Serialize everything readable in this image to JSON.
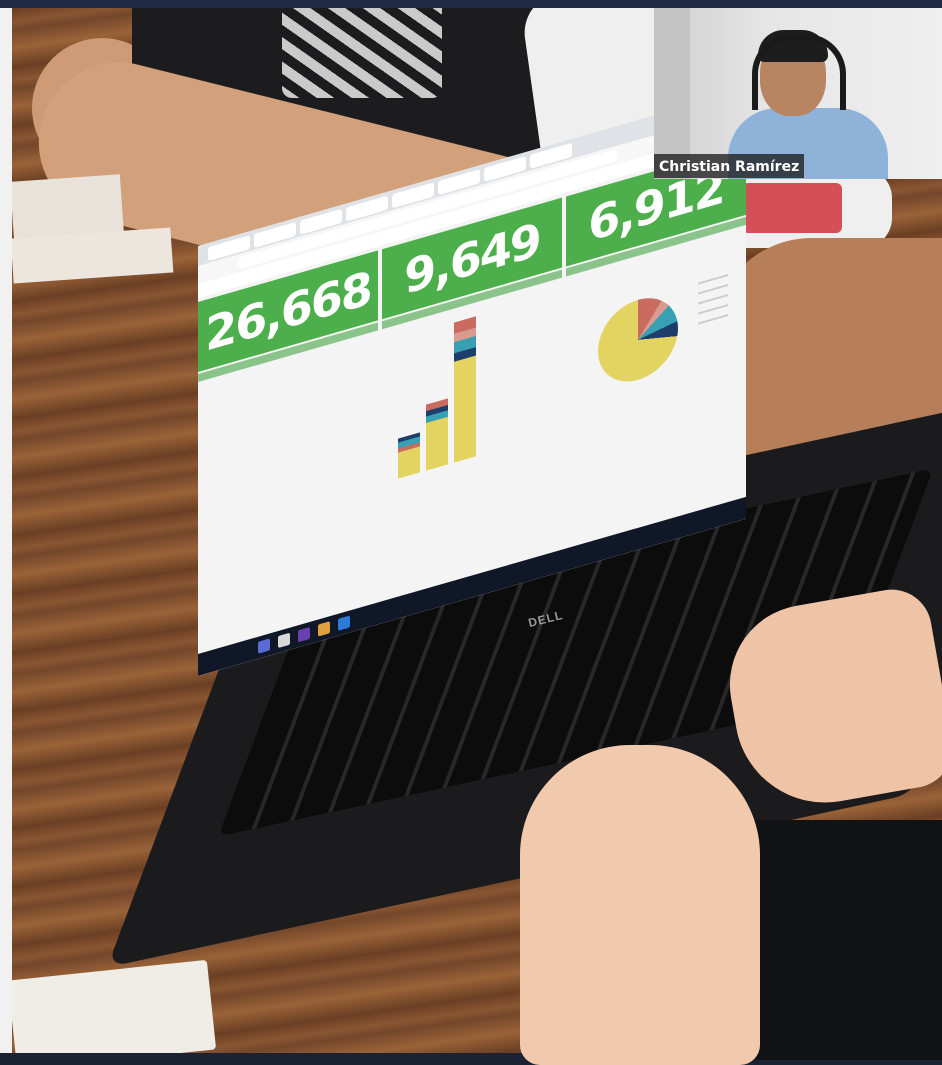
{
  "participant": {
    "name": "Christian Ramírez"
  },
  "dashboard": {
    "kpis": [
      {
        "value": "26,668"
      },
      {
        "value": "9,649"
      },
      {
        "value": "6,912"
      }
    ]
  },
  "laptop": {
    "brand": "DELL"
  },
  "colors": {
    "kpi_green": "#4caf4c",
    "top_bar": "#1f2a44"
  },
  "icons": [
    "microphone-icon",
    "headset-icon"
  ]
}
